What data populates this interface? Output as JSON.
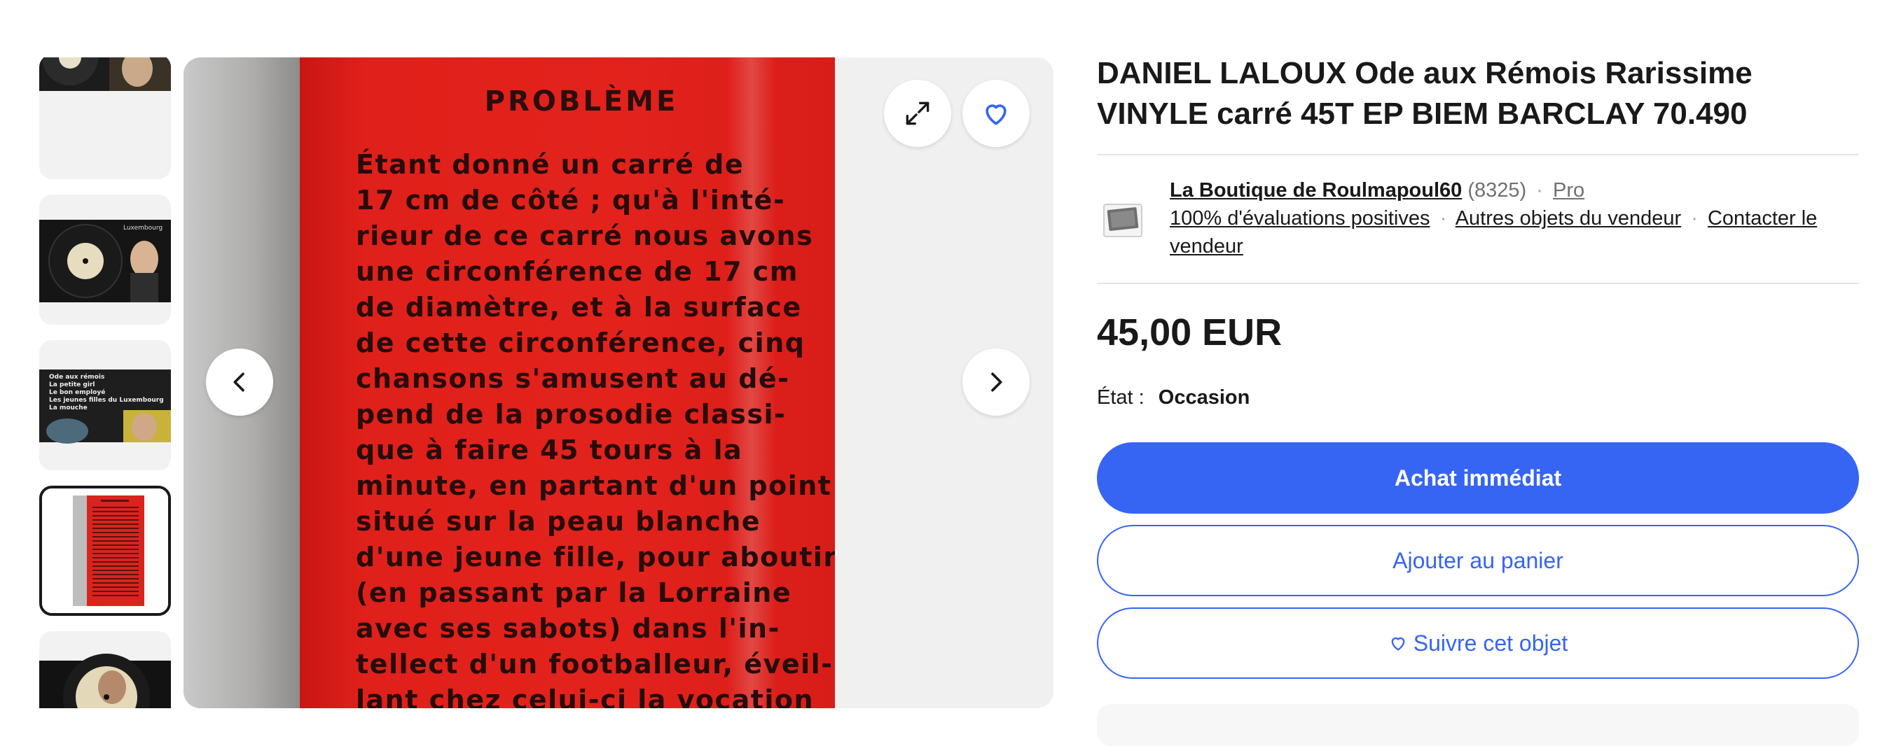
{
  "thumbnails": [
    {
      "label": "",
      "selected": false
    },
    {
      "label": "Luxembourg",
      "selected": false
    },
    {
      "label": "Ode aux rémois / La petite girl / Le bon employé / Les jeunes filles du Luxembourg / La mouche",
      "selected": false
    },
    {
      "label": "",
      "selected": true
    },
    {
      "label": "",
      "selected": false
    }
  ],
  "thumb3_lines": [
    "Ode aux rémois",
    "La petite girl",
    "Le bon employé",
    "Les jeunes filles du Luxembourg",
    "La mouche"
  ],
  "thumb2_caption": "Luxembourg",
  "photo": {
    "heading": "PROBLÈME",
    "lines": [
      "   Étant donné un carré de",
      "17 cm de côté ; qu'à l'inté-",
      "rieur de ce carré nous avons",
      "une circonférence de 17 cm",
      "de diamètre, et à la surface",
      "de cette circonférence, cinq",
      "chansons s'amusent au dé-",
      "pend de la prosodie classi-",
      "que à faire 45 tours à la",
      "minute, en partant d'un point",
      "situé sur la peau blanche",
      "d'une jeune fille, pour aboutir,",
      "(en passant par la Lorraine",
      "avec ses sabots) dans l'in-",
      "tellect d'un footballeur, éveil-",
      "lant chez celui-ci la vocation"
    ]
  },
  "icons": {
    "expand": "expand-icon",
    "favorite": "heart-icon",
    "prev": "chevron-left-icon",
    "next": "chevron-right-icon"
  },
  "listing": {
    "title": "DANIEL LALOUX Ode aux Rémois Rarissime VINYLE carré 45T EP BIEM BARCLAY 70.490",
    "seller": {
      "name": "La Boutique de Roulmapoul60",
      "feedback_count": "(8325)",
      "badge": "Pro",
      "positive": "100% d'évaluations positives",
      "other_items": "Autres objets du vendeur",
      "contact": "Contacter le vendeur"
    },
    "price": "45,00 EUR",
    "condition_label": "État :",
    "condition_value": "Occasion",
    "buy_now": "Achat immédiat",
    "add_to_cart": "Ajouter au panier",
    "watch": "Suivre cet objet"
  },
  "colors": {
    "accent": "#3665f3",
    "text": "#191919",
    "muted": "#707070",
    "sleeve_red": "#e0201a"
  }
}
